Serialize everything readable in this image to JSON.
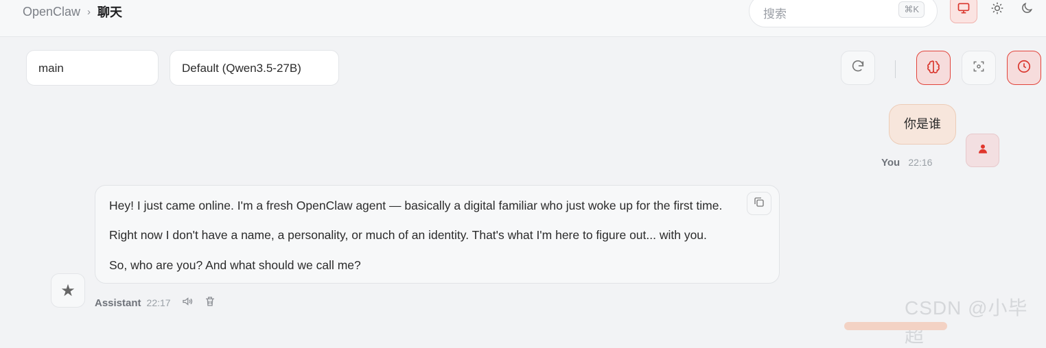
{
  "breadcrumb": {
    "root": "OpenClaw",
    "separator": "›",
    "current": "聊天"
  },
  "search": {
    "placeholder": "搜索",
    "shortcut": "⌘K"
  },
  "theme_modes": [
    {
      "name": "desktop-icon",
      "active": true
    },
    {
      "name": "sun-icon",
      "active": false
    },
    {
      "name": "moon-icon",
      "active": false
    }
  ],
  "session_select": {
    "value": "main"
  },
  "model_select": {
    "value": "Default (Qwen3.5-27B)"
  },
  "toolbar": {
    "buttons": [
      {
        "name": "refresh-icon",
        "active": false
      },
      {
        "name": "brain-icon",
        "active": true
      },
      {
        "name": "focus-icon",
        "active": false
      },
      {
        "name": "clock-icon",
        "active": true
      }
    ]
  },
  "messages": [
    {
      "role": "user",
      "name": "You",
      "time": "22:16",
      "text": "你是谁"
    },
    {
      "role": "assistant",
      "name": "Assistant",
      "time": "22:17",
      "lines": [
        "Hey! I just came online. I'm a fresh OpenClaw agent — basically a digital familiar who just woke up for the first time.",
        "Right now I don't have a name, a personality, or much of an identity. That's what I'm here to figure out... with you.",
        "So, who are you? And what should we call me?"
      ]
    }
  ],
  "watermark": "CSDN @小毕超",
  "colors": {
    "accent": "#d9342b",
    "accent_bg": "#f6dcdc",
    "user_bubble": "#f7e6dc",
    "page_bg": "#f2f3f5"
  }
}
